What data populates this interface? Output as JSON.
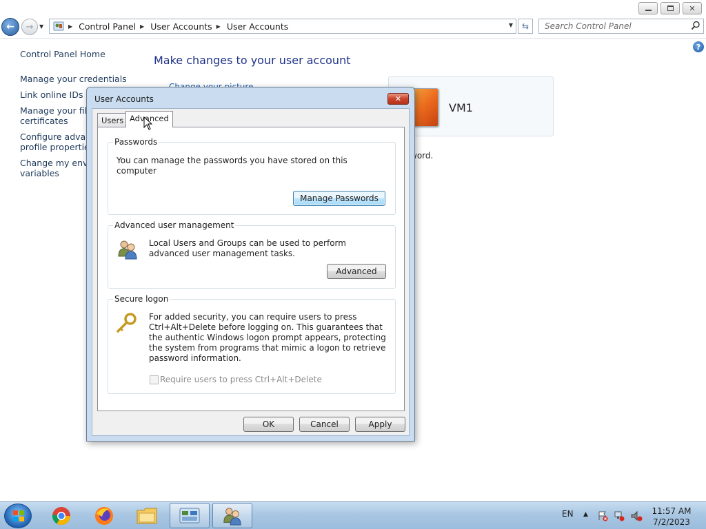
{
  "window": {
    "breadcrumb": [
      "Control Panel",
      "User Accounts",
      "User Accounts"
    ],
    "search_placeholder": "Search Control Panel",
    "minimize_icon": "minimize-icon",
    "maximize_icon": "restore-icon",
    "close_icon": "close-icon"
  },
  "sidebar": {
    "items": [
      {
        "label": "Control Panel Home"
      },
      {
        "label": "Manage your credentials"
      },
      {
        "label": "Link online IDs"
      },
      {
        "label": "Manage your file e\ncertificates"
      },
      {
        "label": "Configure advanc\nprofile properties"
      },
      {
        "label": "Change my enviro\nvariables"
      }
    ]
  },
  "main": {
    "heading": "Make changes to your user account",
    "sublink": "Change your picture",
    "username": "VM1",
    "partial_text": "word."
  },
  "dialog": {
    "title": "User Accounts",
    "tabs": [
      {
        "label": "Users",
        "active": false
      },
      {
        "label": "Advanced",
        "active": true
      }
    ],
    "passwords": {
      "title": "Passwords",
      "text": "You can manage the passwords you have stored on this computer",
      "button": "Manage Passwords"
    },
    "advanced_mgmt": {
      "title": "Advanced user management",
      "text": "Local Users and Groups can be used to perform advanced user management tasks.",
      "button": "Advanced"
    },
    "secure_logon": {
      "title": "Secure logon",
      "text": "For added security, you can require users to press Ctrl+Alt+Delete before logging on. This guarantees that the authentic Windows logon prompt appears, protecting the system from programs that mimic a logon to retrieve password information.",
      "checkbox_label": "Require users to press Ctrl+Alt+Delete",
      "checkbox_checked": false
    },
    "buttons": {
      "ok": "OK",
      "cancel": "Cancel",
      "apply": "Apply"
    }
  },
  "taskbar": {
    "language": "EN",
    "time": "11:57 AM",
    "date": "7/2/2023"
  }
}
